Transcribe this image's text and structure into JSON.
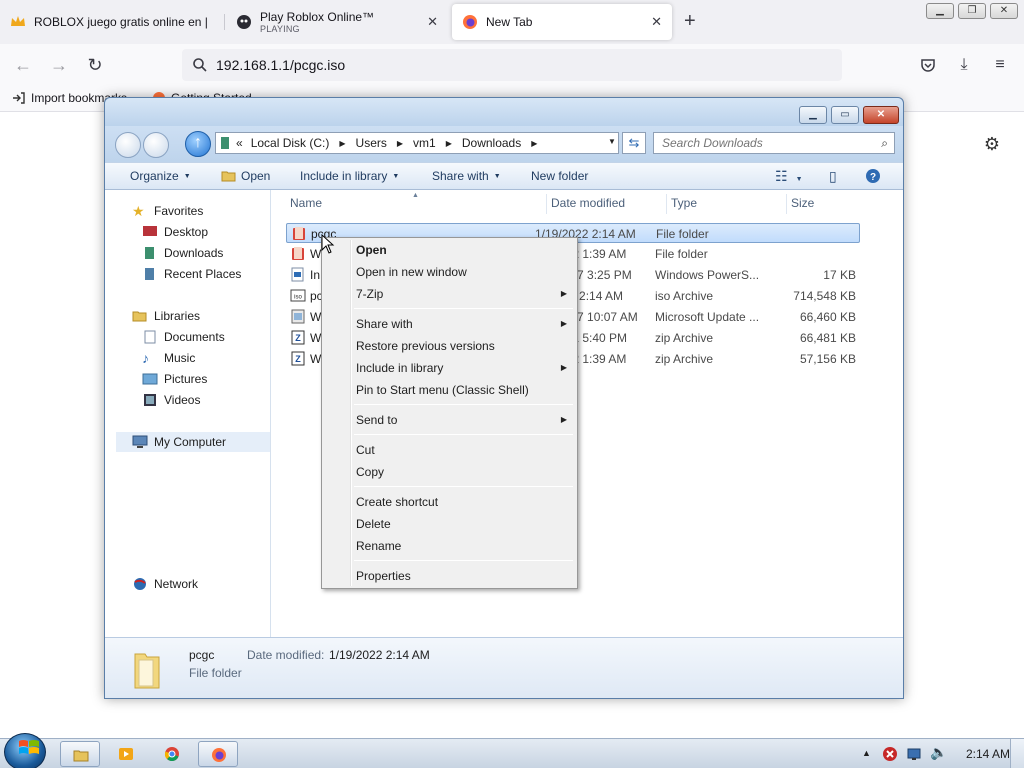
{
  "browser": {
    "tabs": [
      {
        "title": "ROBLOX juego gratis online en |",
        "subtitle": "",
        "icon": "crown-icon"
      },
      {
        "title": "Play Roblox Online™",
        "subtitle": "PLAYING",
        "icon": "roblox-icon"
      },
      {
        "title": "New Tab",
        "subtitle": "",
        "icon": "firefox-icon"
      }
    ],
    "url": "192.168.1.1/pcgc.iso",
    "bookmarks": [
      {
        "label": "Import bookmarks...",
        "icon": "import-icon"
      },
      {
        "label": "Getting Started",
        "icon": "firefox-icon"
      }
    ]
  },
  "explorer": {
    "breadcrumb": [
      "Local Disk (C:)",
      "Users",
      "vm1",
      "Downloads"
    ],
    "breadcrumb_overflow": "«",
    "search_placeholder": "Search Downloads",
    "commands": {
      "organize": "Organize",
      "open": "Open",
      "include_in_library": "Include in library",
      "share_with": "Share with",
      "new_folder": "New folder"
    },
    "nav": {
      "favorites": "Favorites",
      "desktop": "Desktop",
      "downloads": "Downloads",
      "recent_places": "Recent Places",
      "libraries": "Libraries",
      "documents": "Documents",
      "music": "Music",
      "pictures": "Pictures",
      "videos": "Videos",
      "my_computer": "My Computer",
      "network": "Network"
    },
    "columns": {
      "name": "Name",
      "date": "Date modified",
      "type": "Type",
      "size": "Size"
    },
    "files": [
      {
        "name": "pcgc",
        "date": "1/19/2022 2:14 AM",
        "type": "File folder",
        "size": "",
        "icon": "folder-icon"
      },
      {
        "name": "W",
        "date": "/2022 1:39 AM",
        "type": "File folder",
        "size": "",
        "icon": "folder-icon"
      },
      {
        "name": "In",
        "date": "2017 3:25 PM",
        "type": "Windows PowerS...",
        "size": "17 KB",
        "icon": "powershell-icon"
      },
      {
        "name": "pc",
        "date": "2022 2:14 AM",
        "type": "iso Archive",
        "size": "714,548 KB",
        "icon": "iso-icon"
      },
      {
        "name": "W",
        "date": "2017 10:07 AM",
        "type": "Microsoft Update ...",
        "size": "66,460 KB",
        "icon": "update-package-icon"
      },
      {
        "name": "W",
        "date": "/2021 5:40 PM",
        "type": "zip Archive",
        "size": "66,481 KB",
        "icon": "zip-icon"
      },
      {
        "name": "W",
        "date": "/2022 1:39 AM",
        "type": "zip Archive",
        "size": "57,156 KB",
        "icon": "zip-icon"
      }
    ],
    "details": {
      "name": "pcgc",
      "type": "File folder",
      "modified_label": "Date modified:",
      "modified_value": "1/19/2022 2:14 AM"
    }
  },
  "context_menu": {
    "items": [
      {
        "label": "Open",
        "bold": true,
        "submenu": false
      },
      {
        "label": "Open in new window",
        "bold": false,
        "submenu": false
      },
      {
        "label": "7-Zip",
        "bold": false,
        "submenu": true
      },
      {
        "label": "Share with",
        "bold": false,
        "submenu": true
      },
      {
        "label": "Restore previous versions",
        "bold": false,
        "submenu": false
      },
      {
        "label": "Include in library",
        "bold": false,
        "submenu": true
      },
      {
        "label": "Pin to Start menu (Classic Shell)",
        "bold": false,
        "submenu": false
      },
      {
        "label": "Send to",
        "bold": false,
        "submenu": true
      },
      {
        "label": "Cut",
        "bold": false,
        "submenu": false
      },
      {
        "label": "Copy",
        "bold": false,
        "submenu": false
      },
      {
        "label": "Create shortcut",
        "bold": false,
        "submenu": false
      },
      {
        "label": "Delete",
        "bold": false,
        "submenu": false
      },
      {
        "label": "Rename",
        "bold": false,
        "submenu": false
      },
      {
        "label": "Properties",
        "bold": false,
        "submenu": false
      }
    ]
  },
  "taskbar": {
    "apps": [
      "file-explorer-icon",
      "media-player-icon",
      "chrome-icon",
      "firefox-icon"
    ],
    "tray_icons": [
      "show-hidden-icons-icon",
      "security-alert-icon",
      "network-icon",
      "volume-icon"
    ],
    "clock": "2:14 AM"
  },
  "colors": {
    "accent": "#3a78c4",
    "window_frame": "#bcd3ec",
    "selection": "#c1dcfc"
  }
}
